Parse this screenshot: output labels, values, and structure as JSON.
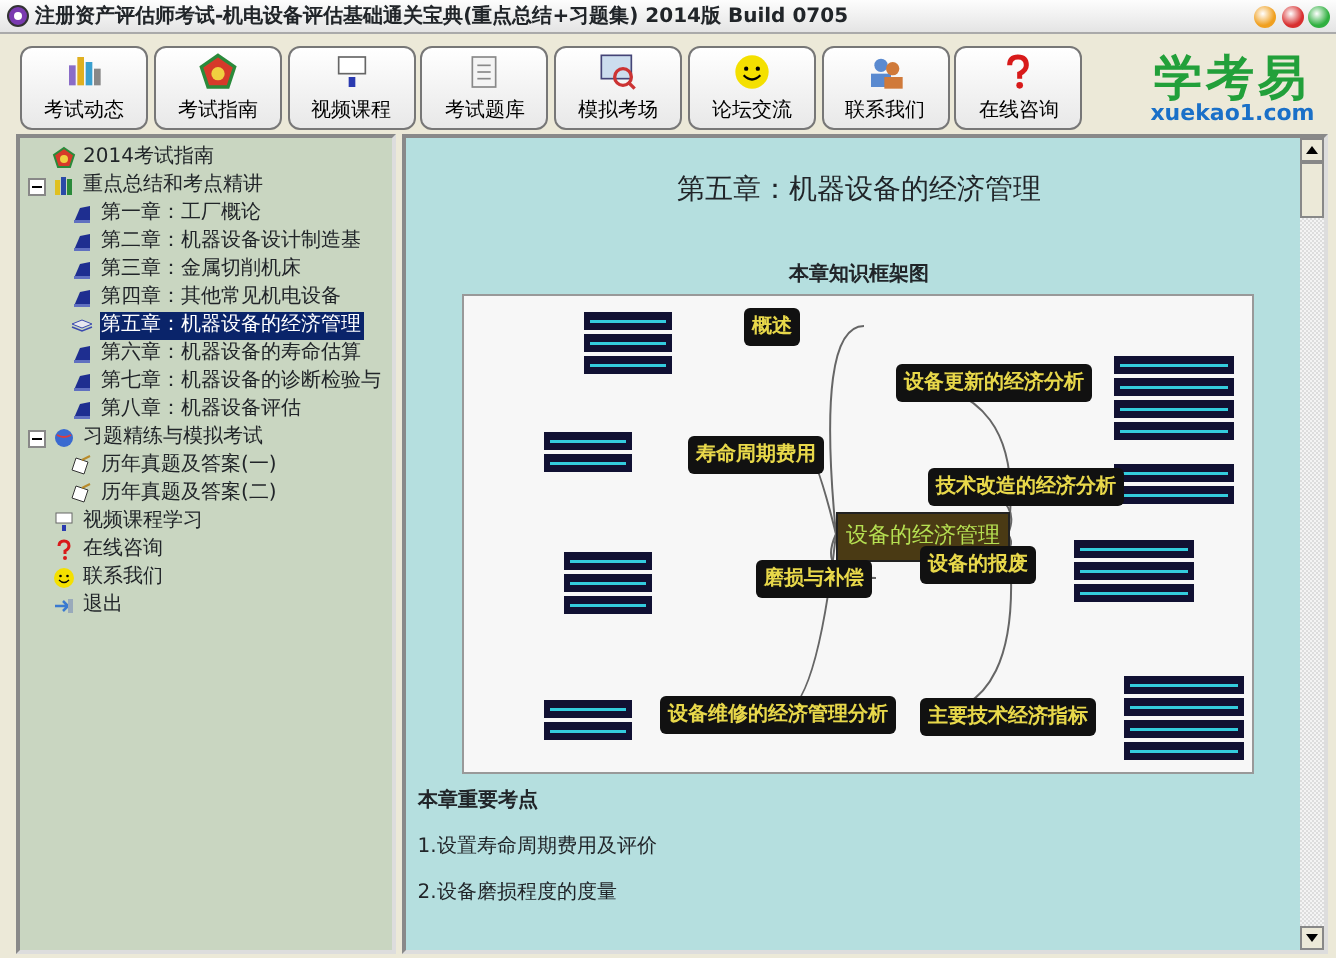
{
  "window": {
    "title": "注册资产评估师考试-机电设备评估基础通关宝典(重点总结+习题集) 2014版 Build 0705"
  },
  "toolbar": [
    {
      "label": "考试动态",
      "kind": "news"
    },
    {
      "label": "考试指南",
      "kind": "guide"
    },
    {
      "label": "视频课程",
      "kind": "video"
    },
    {
      "label": "考试题库",
      "kind": "bank"
    },
    {
      "label": "模拟考场",
      "kind": "exam"
    },
    {
      "label": "论坛交流",
      "kind": "smile"
    },
    {
      "label": "联系我们",
      "kind": "contact"
    },
    {
      "label": "在线咨询",
      "kind": "help"
    }
  ],
  "logo": {
    "text": "学考易",
    "domain": "xuekao1.com"
  },
  "tree": [
    {
      "label": "2014考试指南",
      "kind": "guide",
      "selected": false
    },
    {
      "label": "重点总结和考点精讲",
      "kind": "books",
      "selected": false,
      "expanded": true,
      "children": [
        {
          "label": "第一章：工厂概论",
          "kind": "book",
          "selected": false
        },
        {
          "label": "第二章：机器设备设计制造基",
          "kind": "book",
          "selected": false
        },
        {
          "label": "第三章：金属切削机床",
          "kind": "book",
          "selected": false
        },
        {
          "label": "第四章：其他常见机电设备",
          "kind": "book",
          "selected": false
        },
        {
          "label": "第五章：机器设备的经济管理",
          "kind": "open",
          "selected": true
        },
        {
          "label": "第六章：机器设备的寿命估算",
          "kind": "book",
          "selected": false
        },
        {
          "label": "第七章：机器设备的诊断检验与",
          "kind": "book",
          "selected": false
        },
        {
          "label": "第八章：机器设备评估",
          "kind": "book",
          "selected": false
        }
      ]
    },
    {
      "label": "习题精练与模拟考试",
      "kind": "quiz",
      "selected": false,
      "expanded": true,
      "children": [
        {
          "label": "历年真题及答案(一)",
          "kind": "paper",
          "selected": false
        },
        {
          "label": "历年真题及答案(二)",
          "kind": "paper",
          "selected": false
        }
      ]
    },
    {
      "label": "视频课程学习",
      "kind": "video",
      "selected": false
    },
    {
      "label": "在线咨询",
      "kind": "help",
      "selected": false
    },
    {
      "label": "联系我们",
      "kind": "smile",
      "selected": false
    },
    {
      "label": "退出",
      "kind": "exit",
      "selected": false
    }
  ],
  "content": {
    "title": "第五章：机器设备的经济管理",
    "figure_caption": "本章知识框架图",
    "mindmap": {
      "center": "设备的经济管理",
      "branches": [
        "概述",
        "寿命周期费用",
        "磨损与补偿",
        "设备维修的经济管理分析",
        "设备更新的经济分析",
        "技术改造的经济分析",
        "设备的报废",
        "主要技术经济指标"
      ]
    },
    "section_heading": "本章重要考点",
    "points": [
      "1.设置寿命周期费用及评价",
      "2.设备磨损程度的度量"
    ]
  }
}
